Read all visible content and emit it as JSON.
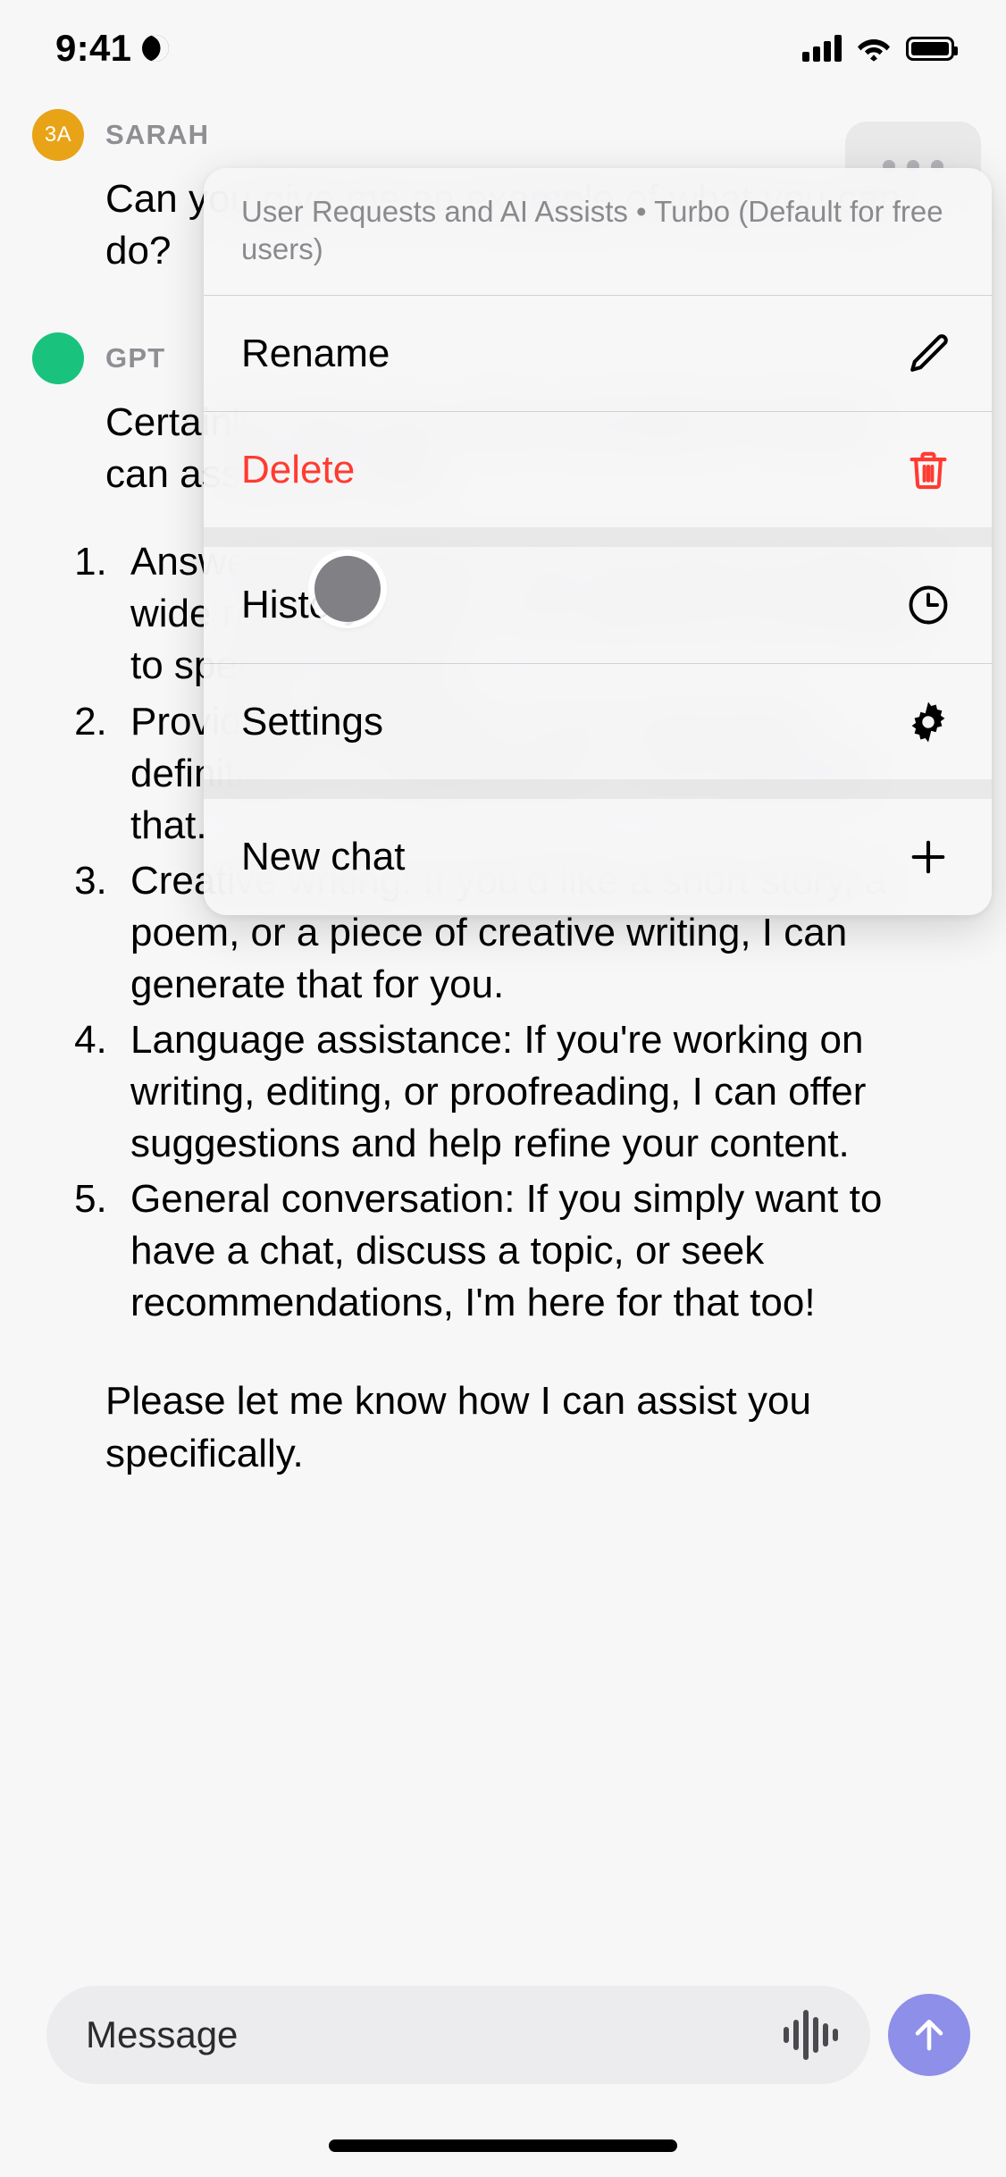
{
  "status_bar": {
    "time": "9:41",
    "dnd_icon": "moon-icon",
    "cellular_icon": "cellular-signal-icon",
    "wifi_icon": "wifi-icon",
    "battery_icon": "battery-full-icon"
  },
  "messages": [
    {
      "author": "SARAH",
      "avatar_initials": "3A",
      "avatar_color": "#e8a317",
      "text": "Can you give me an example of what you can do?"
    },
    {
      "author": "GPT",
      "avatar_initials": "",
      "avatar_color": "#19c37d",
      "text": "Certainly! Here are a few examples of what I can assist you with:",
      "points": [
        "Answering questions: You can ask me about a wide range of topics, from general knowledge to specific subjects.",
        "Providing information: If you need facts, definitions, or explanations, I can help with that.",
        "Creative writing: If you'd like a short story, a poem, or a piece of creative writing, I can generate that for you.",
        "Language assistance: If you're working on writing, editing, or proofreading, I can offer suggestions and help refine your content.",
        "General conversation: If you simply want to have a chat, discuss a topic, or seek recommendations, I'm here for that too!"
      ],
      "closing": "Please let me know how I can assist you specifically."
    }
  ],
  "more_button": {
    "icon": "ellipsis-icon"
  },
  "context_menu": {
    "header": "User Requests and AI Assists • Turbo (Default for free users)",
    "items": [
      {
        "label": "Rename",
        "icon": "pencil-icon",
        "destructive": false
      },
      {
        "label": "Delete",
        "icon": "trash-icon",
        "destructive": true
      },
      {
        "label": "History",
        "icon": "clock-icon",
        "destructive": false
      },
      {
        "label": "Settings",
        "icon": "gear-icon",
        "destructive": false
      },
      {
        "label": "New chat",
        "icon": "plus-icon",
        "destructive": false
      }
    ],
    "destructive_color": "#ff3b30"
  },
  "touch_indicator": {
    "name": "touch-point"
  },
  "composer": {
    "placeholder": "Message",
    "voice_icon": "waveform-icon",
    "send_icon": "arrow-up-icon",
    "send_color": "#8e8fe8"
  },
  "home_indicator": {
    "name": "home-indicator"
  }
}
